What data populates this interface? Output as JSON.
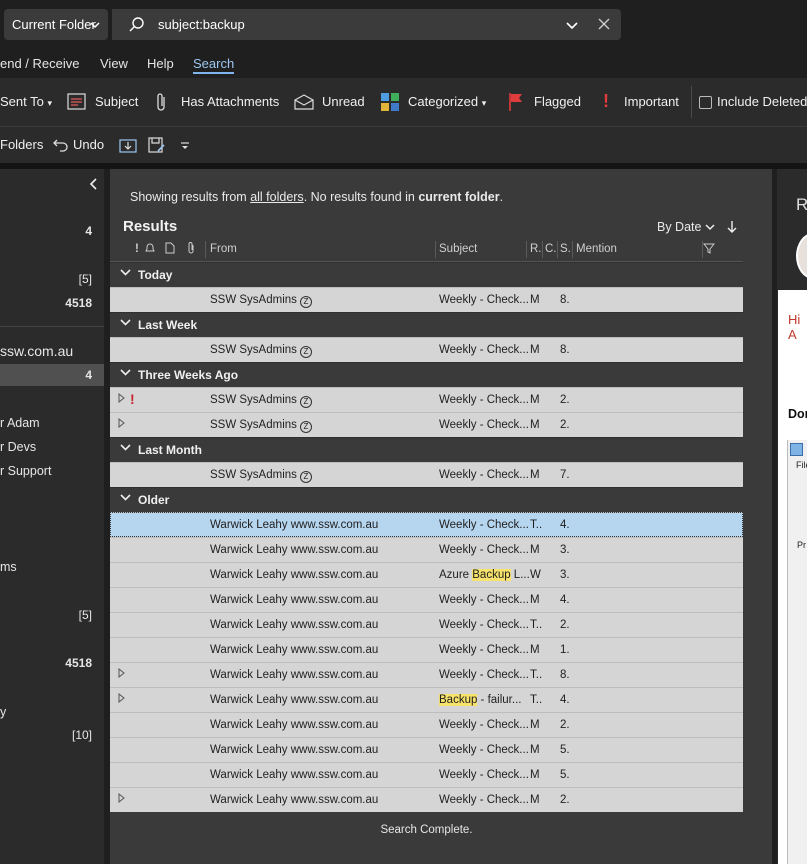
{
  "search": {
    "scope": "Current Folder",
    "query": "subject:backup"
  },
  "tabs": [
    "end / Receive",
    "View",
    "Help",
    "Search"
  ],
  "ribbon": {
    "sent_to": "Sent To",
    "subject": "Subject",
    "has_attachments": "Has Attachments",
    "unread": "Unread",
    "categorized": "Categorized",
    "flagged": "Flagged",
    "important": "Important",
    "include_deleted": "Include Deleted"
  },
  "ribbon2": {
    "folders": "Folders",
    "undo": "Undo"
  },
  "left_nav": {
    "count_1": "4",
    "count_2": "[5]",
    "count_3": "4518",
    "account": "ssw.com.au",
    "count_sel": "4",
    "item_adam": "r Adam",
    "item_devs": "r Devs",
    "item_support": "r Support",
    "item_ms": "ms",
    "count_4": "[5]",
    "count_5": "4518",
    "item_y": "y",
    "count_6": "[10]"
  },
  "results": {
    "notice_pre": "Showing results from ",
    "notice_link": "all folders",
    "notice_mid": ". No results found in ",
    "notice_bold": "current folder",
    "notice_end": ".",
    "title": "Results",
    "sort": "By Date",
    "columns": {
      "from": "From",
      "subject": "Subject",
      "r": "R.",
      "c": "C.",
      "s": "S.",
      "mention": "Mention"
    },
    "groups": [
      {
        "label": "Today",
        "rows": [
          {
            "from": "SSW SysAdmins",
            "zicon": true,
            "subject": "Weekly - Check...",
            "r": "M",
            "s": "8."
          }
        ]
      },
      {
        "label": "Last Week",
        "rows": [
          {
            "from": "SSW SysAdmins",
            "zicon": true,
            "subject": "Weekly - Check...",
            "r": "M",
            "s": "8."
          }
        ]
      },
      {
        "label": "Three Weeks Ago",
        "rows": [
          {
            "from": "SSW SysAdmins",
            "zicon": true,
            "subject": "Weekly - Check...",
            "r": "M",
            "s": "2.",
            "expand": true,
            "important": true
          },
          {
            "from": "SSW SysAdmins",
            "zicon": true,
            "subject": "Weekly - Check...",
            "r": "M",
            "s": "2.",
            "expand": true
          }
        ]
      },
      {
        "label": "Last Month",
        "rows": [
          {
            "from": "SSW SysAdmins",
            "zicon": true,
            "subject": "Weekly - Check...",
            "r": "M",
            "s": "7."
          }
        ]
      },
      {
        "label": "Older",
        "rows": [
          {
            "from": "Warwick Leahy www.ssw.com.au",
            "subject": "Weekly - Check...",
            "r": "T..",
            "s": "4.",
            "selected": true
          },
          {
            "from": "Warwick Leahy www.ssw.com.au",
            "subject": "Weekly - Check...",
            "r": "M",
            "s": "3."
          },
          {
            "from": "Warwick Leahy www.ssw.com.au",
            "subject_pre": "Azure ",
            "subject_hl": "Backup",
            "subject_post": " L...",
            "r": "W",
            "s": "3."
          },
          {
            "from": "Warwick Leahy www.ssw.com.au",
            "subject": "Weekly - Check...",
            "r": "M",
            "s": "4."
          },
          {
            "from": "Warwick Leahy www.ssw.com.au",
            "subject": "Weekly - Check...",
            "r": "T..",
            "s": "2."
          },
          {
            "from": "Warwick Leahy www.ssw.com.au",
            "subject": "Weekly - Check...",
            "r": "M",
            "s": "1."
          },
          {
            "from": "Warwick Leahy www.ssw.com.au",
            "subject": "Weekly - Check...",
            "r": "T..",
            "s": "8.",
            "expand": true
          },
          {
            "from": "Warwick Leahy www.ssw.com.au",
            "subject_pre": "",
            "subject_hl": "Backup",
            "subject_post": " - failur...",
            "r": "T..",
            "s": "4.",
            "expand": true
          },
          {
            "from": "Warwick Leahy www.ssw.com.au",
            "subject": "Weekly - Check...",
            "r": "M",
            "s": "2."
          },
          {
            "from": "Warwick Leahy www.ssw.com.au",
            "subject": "Weekly - Check...",
            "r": "M",
            "s": "5."
          },
          {
            "from": "Warwick Leahy www.ssw.com.au",
            "subject": "Weekly - Check...",
            "r": "M",
            "s": "5."
          },
          {
            "from": "Warwick Leahy www.ssw.com.au",
            "subject": "Weekly - Check...",
            "r": "M",
            "s": "2.",
            "expand": true
          }
        ]
      }
    ],
    "status": "Search Complete."
  },
  "reading": {
    "letter_r": "R",
    "greeting": "Hi A",
    "bold_text": "Dor",
    "file_text": "File",
    "pr_text": "Pr"
  }
}
